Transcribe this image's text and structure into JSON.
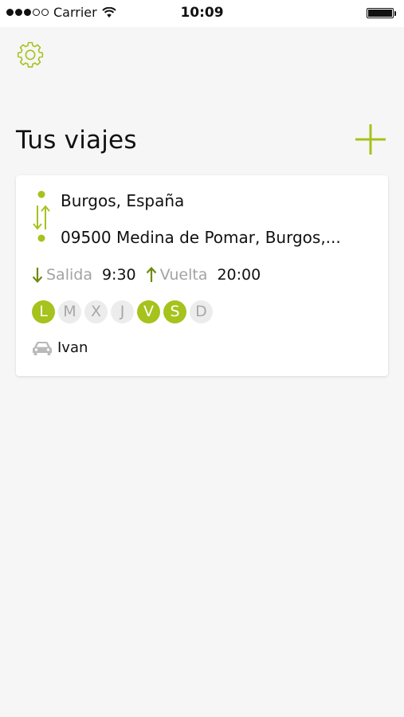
{
  "status_bar": {
    "carrier": "Carrier",
    "time": "10:09"
  },
  "header": {
    "title": "Tus viajes"
  },
  "colors": {
    "accent": "#a6c21c",
    "muted": "#a3a3a3",
    "background": "#f6f6f6",
    "card": "#ffffff"
  },
  "trip": {
    "origin": "Burgos, España",
    "destination": "09500 Medina de Pomar, Burgos,...",
    "departure_label": "Salida",
    "departure_time": "9:30",
    "return_label": "Vuelta",
    "return_time": "20:00",
    "days": [
      {
        "letter": "L",
        "active": true
      },
      {
        "letter": "M",
        "active": false
      },
      {
        "letter": "X",
        "active": false
      },
      {
        "letter": "J",
        "active": false
      },
      {
        "letter": "V",
        "active": true
      },
      {
        "letter": "S",
        "active": true
      },
      {
        "letter": "D",
        "active": false
      }
    ],
    "driver": "Ivan"
  },
  "icons": {
    "settings": "gear-icon",
    "add": "plus-icon",
    "route": "swap-vertical-icon",
    "departure": "arrow-down-icon",
    "return": "arrow-up-icon",
    "driver": "car-icon"
  }
}
